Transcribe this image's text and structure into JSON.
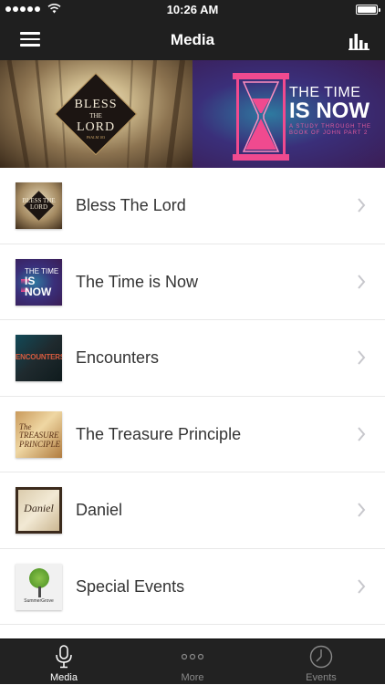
{
  "status_bar": {
    "time": "10:26 AM",
    "signal_icon": "signal-dots-icon",
    "wifi_icon": "wifi-icon",
    "battery_icon": "battery-icon"
  },
  "nav": {
    "title": "Media",
    "menu_icon": "hamburger-menu-icon",
    "stats_icon": "bar-chart-icon"
  },
  "banner": {
    "bless": {
      "line1": "BLESS",
      "line2": "THE",
      "line3": "LORD",
      "line4": "PSALM 103"
    },
    "time": {
      "line1": "THE TIME",
      "line2": "IS NOW",
      "line3": "A STUDY THROUGH THE BOOK OF JOHN PART 2"
    }
  },
  "items": [
    {
      "label": "Bless The Lord",
      "thumb_text": "BLESS THE LORD"
    },
    {
      "label": "The Time is Now",
      "thumb_text_top": "THE TIME",
      "thumb_text_bottom": "IS NOW"
    },
    {
      "label": "Encounters",
      "thumb_text": "ENCOUNTERS"
    },
    {
      "label": "The Treasure Principle",
      "thumb_text_a": "The",
      "thumb_text_b": "TREASURE",
      "thumb_text_c": "PRINCIPLE"
    },
    {
      "label": "Daniel",
      "thumb_text": "Daniel"
    },
    {
      "label": "Special Events",
      "thumb_text": "SummerGrove"
    }
  ],
  "tabs": [
    {
      "label": "Media",
      "icon": "microphone-icon",
      "active": true
    },
    {
      "label": "More",
      "icon": "more-dots-icon",
      "active": false
    },
    {
      "label": "Events",
      "icon": "clock-icon",
      "active": false
    }
  ],
  "colors": {
    "bar_bg": "#1f1f1f",
    "tab_active": "#ffffff",
    "tab_inactive": "#8a8a8a",
    "chevron": "#c7c7cc"
  }
}
